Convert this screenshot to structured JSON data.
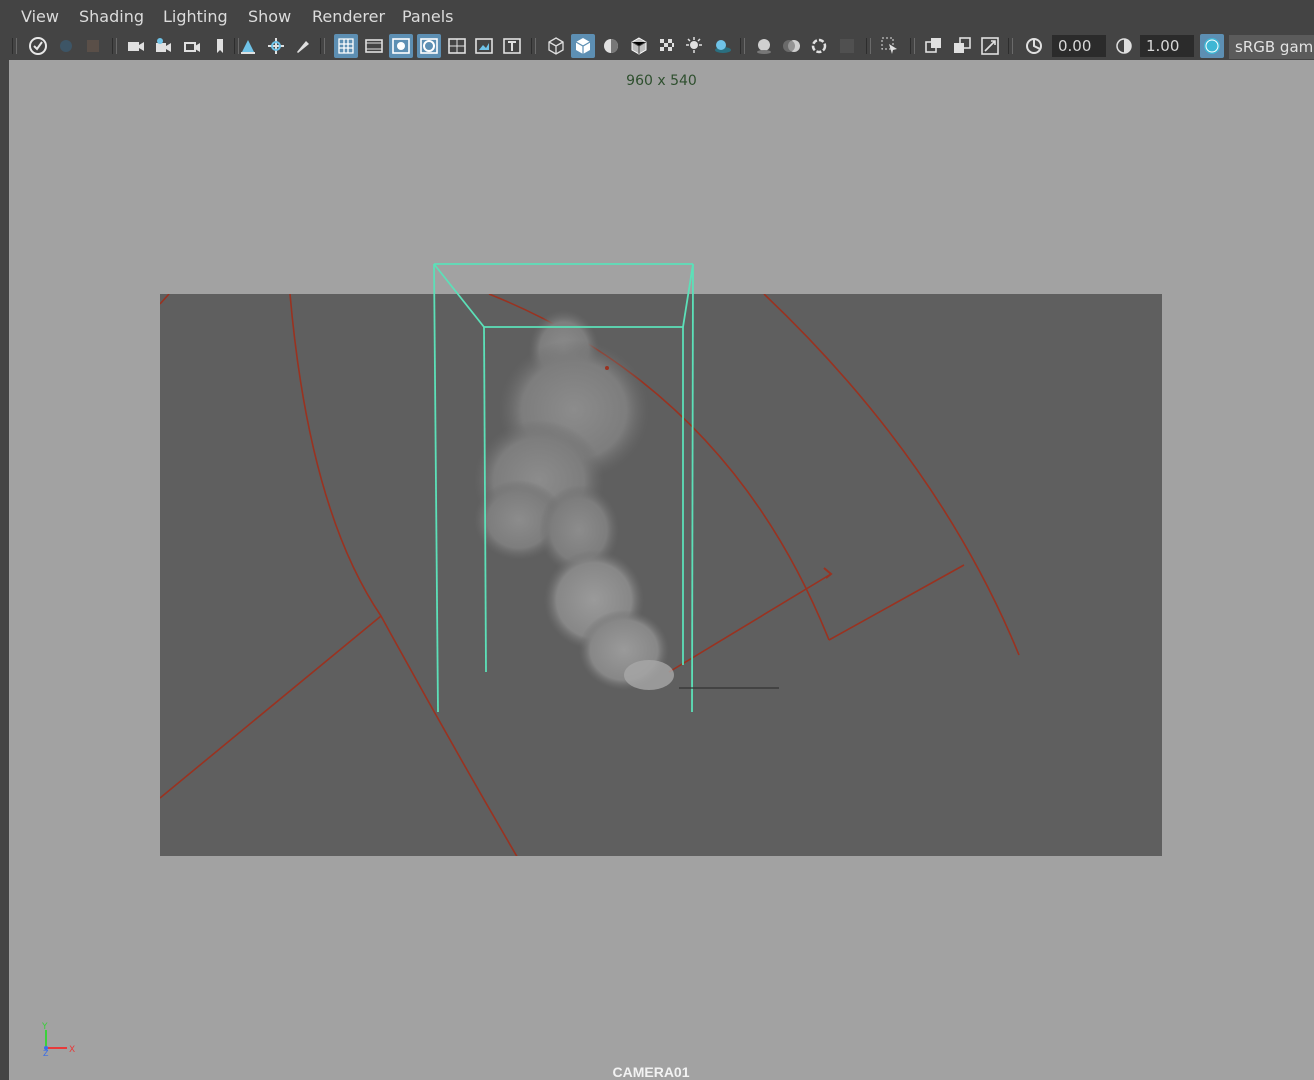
{
  "menubar": {
    "items": [
      "View",
      "Shading",
      "Lighting",
      "Show",
      "Renderer",
      "Panels"
    ]
  },
  "toolbar": {
    "icons": [
      "select-camera-icon",
      "lock-camera-icon",
      "bookmark-icon",
      "camera-attributes-icon",
      "camera-bookmark-icon",
      "2d-pan-zoom-icon",
      "grease-pencil-icon",
      "image-plane-icon",
      "2d-pan-icon",
      "paint-icon",
      "grid-icon",
      "film-gate-icon",
      "resolution-gate-icon",
      "gate-mask-icon",
      "field-chart-icon",
      "safe-action-icon",
      "safe-title-icon",
      "wireframe-icon",
      "smooth-shade-icon",
      "use-default-material-icon",
      "wireframe-on-shaded-icon",
      "textured-icon",
      "use-all-lights-icon",
      "shadows-icon",
      "screen-space-ao-icon",
      "motion-blur-icon",
      "multisample-aa-icon",
      "depth-of-field-icon",
      "isolate-select-icon",
      "xray-icon",
      "xray-active-icon",
      "xray-joints-icon",
      "exposure-icon",
      "gamma-icon",
      "color-management-toggle-icon"
    ],
    "exposure_value": "0.00",
    "gamma_value": "1.00",
    "color_space": "sRGB gam"
  },
  "viewport": {
    "resolution_label": "960 x 540",
    "camera_label": "CAMERA01",
    "axis_labels": {
      "y": "Y",
      "x": "X",
      "z": "Z"
    }
  },
  "colors": {
    "ui_bg": "#444444",
    "viewport_bg": "#a2a2a2",
    "gate_bg": "#5f5f5f",
    "fluid_container": "#5ce0b8",
    "curve_red": "#9a3220",
    "toolbar_active": "#5d8fb3"
  }
}
